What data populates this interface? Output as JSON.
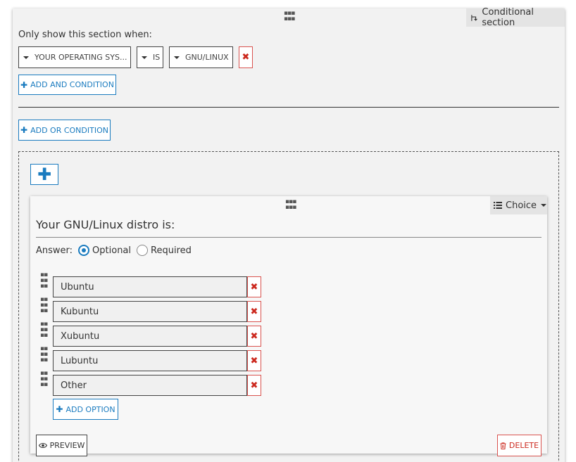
{
  "section": {
    "badge_label": "Conditional section",
    "condition_intro": "Only show this section when:",
    "condition": {
      "field": "YOUR OPERATING SYS...",
      "operator": "IS",
      "value": "GNU/LINUX"
    },
    "remove_symbol": "✖",
    "add_and_label": "ADD AND CONDITION",
    "add_or_label": "ADD OR CONDITION",
    "add_block_symbol": "✚"
  },
  "question": {
    "type_label": "Choice",
    "title": "Your GNU/Linux distro is:",
    "answer_label": "Answer:",
    "optional_label": "Optional",
    "required_label": "Required",
    "answer_mode": "Optional",
    "options": [
      "Ubuntu",
      "Kubuntu",
      "Xubuntu",
      "Lubuntu",
      "Other"
    ],
    "add_option_label": "ADD OPTION",
    "preview_label": "PREVIEW",
    "delete_label": "DELETE"
  },
  "icons": {
    "grip": "drag-grip-icon",
    "branch": "branch-icon",
    "list": "list-icon",
    "plus": "plus-icon",
    "close": "close-icon",
    "eye": "eye-icon",
    "trash": "trash-icon"
  },
  "colors": {
    "accent": "#1a7bbf",
    "danger": "#cc2a1f",
    "panel": "#f2f2f2"
  }
}
